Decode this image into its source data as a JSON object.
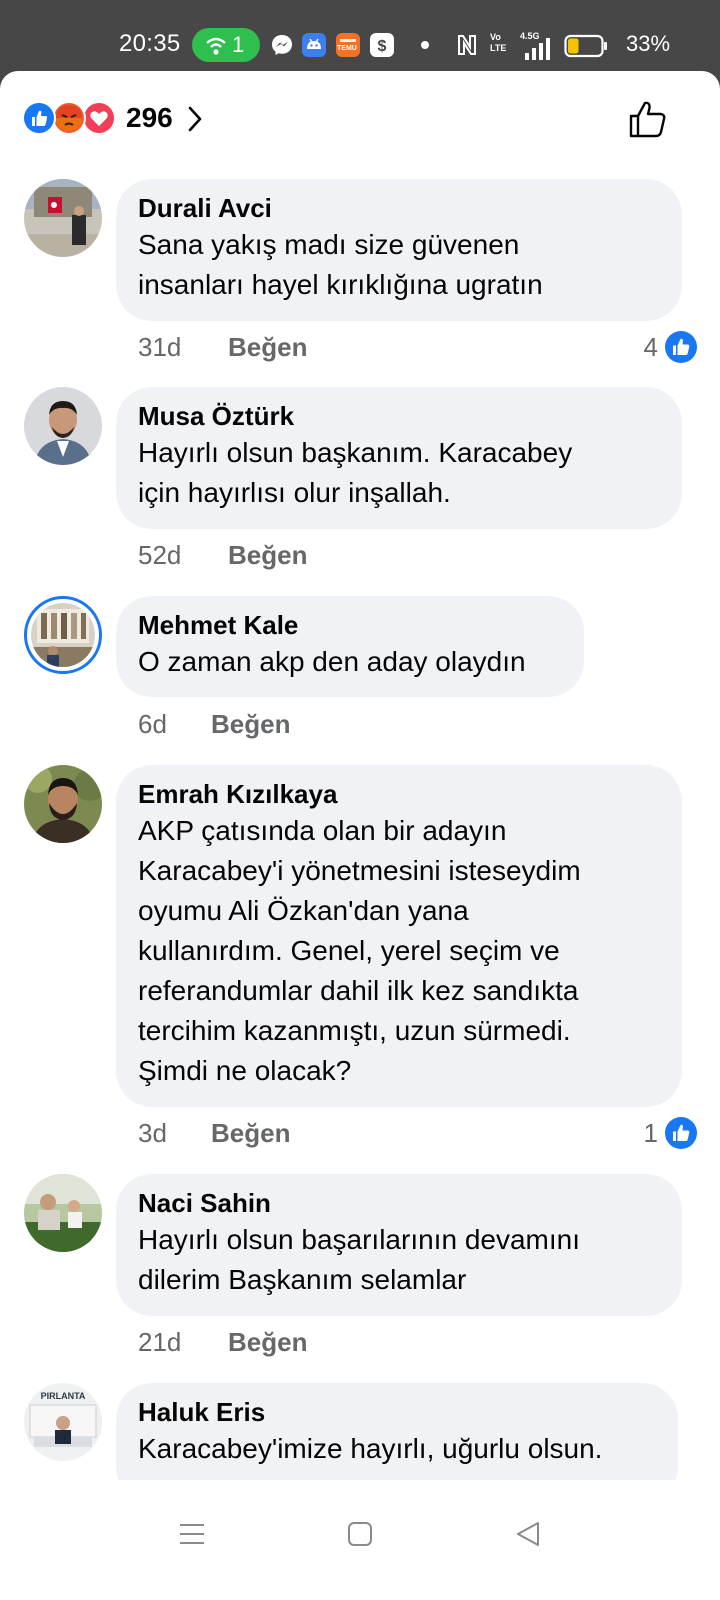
{
  "status_bar": {
    "time": "20:35",
    "hotspot_count": "1",
    "network_tag": "4.5G",
    "volte_label": "Vo LTE",
    "temu_label": "TEMU",
    "battery_percent": "33%",
    "battery_level": 0.33,
    "colors": {
      "bg": "#474747",
      "hotspot": "#2fbf4f",
      "battery_fill": "#f5c400"
    }
  },
  "reactions": {
    "types": [
      "like",
      "angry",
      "love"
    ],
    "count": "296"
  },
  "comments": [
    {
      "author": "Durali Avci",
      "lines": [
        "Sana yakış madı size güvenen",
        "insanları hayel kırıklığına ugratın"
      ],
      "age": "31d",
      "like_label": "Beğen",
      "likes": "4"
    },
    {
      "author": "Musa Öztürk",
      "lines": [
        "Hayırlı olsun başkanım. Karacabey",
        "için hayırlısı olur inşallah."
      ],
      "age": "52d",
      "like_label": "Beğen",
      "likes": ""
    },
    {
      "author": "Mehmet Kale",
      "lines": [
        "O zaman akp den aday olaydın"
      ],
      "age": "6d",
      "like_label": "Beğen",
      "likes": ""
    },
    {
      "author": "Emrah Kızılkaya",
      "lines": [
        "AKP çatısında olan bir adayın",
        "Karacabey'i yönetmesini isteseydim",
        "oyumu Ali Özkan'dan yana",
        "kullanırdım. Genel, yerel seçim ve",
        "referandumlar dahil ilk kez sandıkta",
        "tercihim kazanmıştı, uzun sürmedi.",
        "Şimdi ne olacak?"
      ],
      "age": "3d",
      "like_label": "Beğen",
      "likes": "1"
    },
    {
      "author": "Naci Sahin",
      "lines": [
        "Hayırlı olsun başarılarının devamını",
        "dilerim Başkanım selamlar"
      ],
      "age": "21d",
      "like_label": "Beğen",
      "likes": ""
    },
    {
      "author": "Haluk Eris",
      "lines": [
        "Karacabey'imize hayırlı, uğurlu olsun."
      ],
      "avatar_text": "PIRLANTA",
      "age": "",
      "like_label": "",
      "likes": ""
    }
  ],
  "colors": {
    "accent": "#1877f2",
    "bubble": "#f0f2f5",
    "secondary_text": "#65676b"
  },
  "nav_bar": {
    "buttons": [
      "menu-icon",
      "home-square-icon",
      "back-triangle-icon"
    ]
  }
}
